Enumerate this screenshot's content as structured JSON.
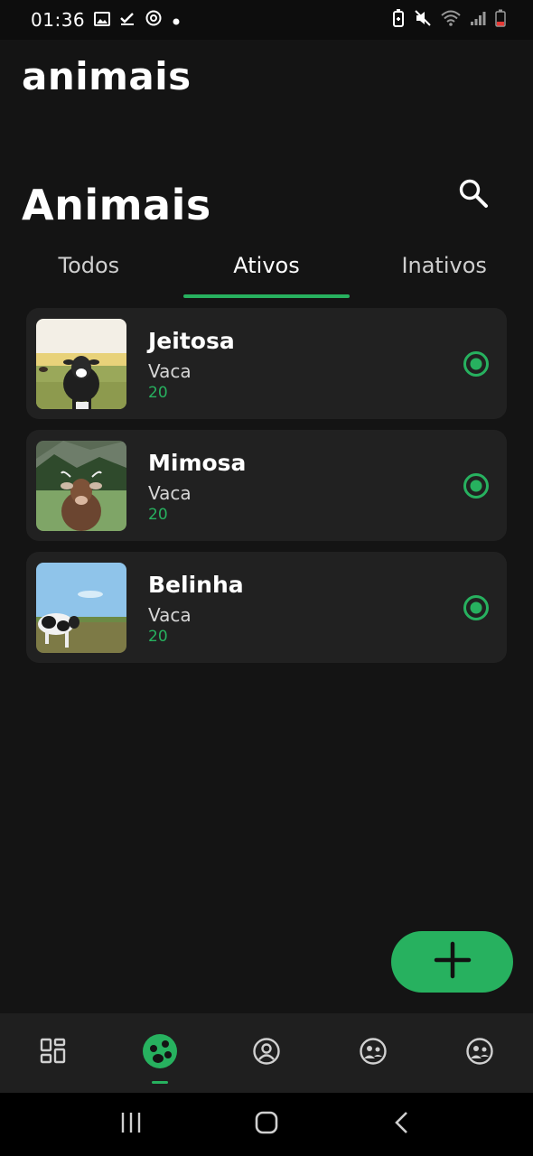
{
  "status_bar": {
    "time": "01:36",
    "icons_left": [
      "image-icon",
      "check-icon",
      "sync-icon",
      "dot-icon"
    ],
    "icons_right": [
      "battery-saver-icon",
      "mute-icon",
      "wifi-icon",
      "signal-icon",
      "battery-icon"
    ]
  },
  "app": {
    "title": "animais"
  },
  "page": {
    "title": "Animais",
    "search_icon": "search-icon"
  },
  "tabs": [
    {
      "label": "Todos",
      "active": false
    },
    {
      "label": "Ativos",
      "active": true
    },
    {
      "label": "Inativos",
      "active": false
    }
  ],
  "animals": [
    {
      "name": "Jeitosa",
      "species": "Vaca",
      "age": "20",
      "status": "active"
    },
    {
      "name": "Mimosa",
      "species": "Vaca",
      "age": "20",
      "status": "active"
    },
    {
      "name": "Belinha",
      "species": "Vaca",
      "age": "20",
      "status": "active"
    }
  ],
  "fab": {
    "icon": "plus-icon"
  },
  "bottom_nav": [
    {
      "icon": "dashboard-icon",
      "active": false
    },
    {
      "icon": "animals-icon",
      "active": true
    },
    {
      "icon": "profile-icon",
      "active": false
    },
    {
      "icon": "group-icon",
      "active": false
    },
    {
      "icon": "group-alt-icon",
      "active": false
    }
  ],
  "colors": {
    "accent": "#27b15f",
    "background": "#141414",
    "card": "#212121",
    "nav": "#1f1f1f"
  }
}
